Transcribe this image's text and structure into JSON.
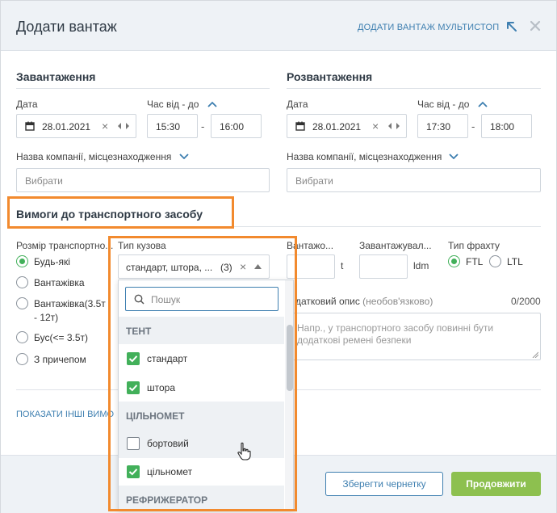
{
  "header": {
    "title": "Додати вантаж",
    "multistop_link": "ДОДАТИ ВАНТАЖ МУЛЬТИСТОП",
    "collapse_icon": "arrow-up-left-icon",
    "close_icon": "close-icon"
  },
  "loading": {
    "title": "Завантаження",
    "date_label": "Дата",
    "date_value": "28.01.2021",
    "time_label": "Час від - до",
    "time_from": "15:30",
    "time_to": "16:00",
    "company_label": "Назва компанії, місцезнаходження",
    "company_placeholder": "Вибрати"
  },
  "unloading": {
    "title": "Розвантаження",
    "date_label": "Дата",
    "date_value": "28.01.2021",
    "time_label": "Час від - до",
    "time_from": "17:30",
    "time_to": "18:00",
    "company_label": "Назва компанії, місцезнаходження",
    "company_placeholder": "Вибрати"
  },
  "vehicle": {
    "title": "Вимоги до транспортного засобу",
    "size_label": "Розмір транспортно...",
    "size_options": [
      "Будь-які",
      "Вантажівка",
      "Вантажівка(3.5т",
      "- 12т)",
      "Бус(<= 3.5т)",
      "З причепом"
    ],
    "size_selected": "Будь-які",
    "body_label": "Тип кузова",
    "body_value": "стандарт, штора, ...",
    "body_count": "(3)",
    "weight_label": "Вантажо...",
    "weight_unit": "t",
    "ldm_label": "Завантажувал...",
    "ldm_unit": "ldm",
    "freight_label": "Тип фрахту",
    "freight_options": [
      "FTL",
      "LTL"
    ],
    "freight_selected": "FTL",
    "desc_label": "даткoвий опис",
    "desc_optional": "(необов'язково)",
    "desc_counter": "0/2000",
    "desc_placeholder_1": "Напр., у транспортного засобу повинні бути",
    "desc_placeholder_2": "додаткові ремені безпеки",
    "show_more": "ПОКАЗАТИ ІНШІ ВИМО"
  },
  "dropdown": {
    "search_placeholder": "Пошук",
    "groups": [
      "ТЕНТ",
      "ЦІЛЬНОМЕТ",
      "РЕФРИЖЕРАТОР"
    ],
    "items": [
      {
        "label": "стандарт",
        "checked": true
      },
      {
        "label": "штора",
        "checked": true
      },
      {
        "label": "бортовий",
        "checked": false
      },
      {
        "label": "цільномет",
        "checked": true
      }
    ]
  },
  "footer": {
    "save_draft": "Зберегти чернетку",
    "continue": "Продовжити"
  },
  "colors": {
    "accent_blue": "#3e7fb0",
    "green": "#42b05a",
    "button_green": "#8dc04f",
    "highlight_orange": "#f28a2e"
  }
}
